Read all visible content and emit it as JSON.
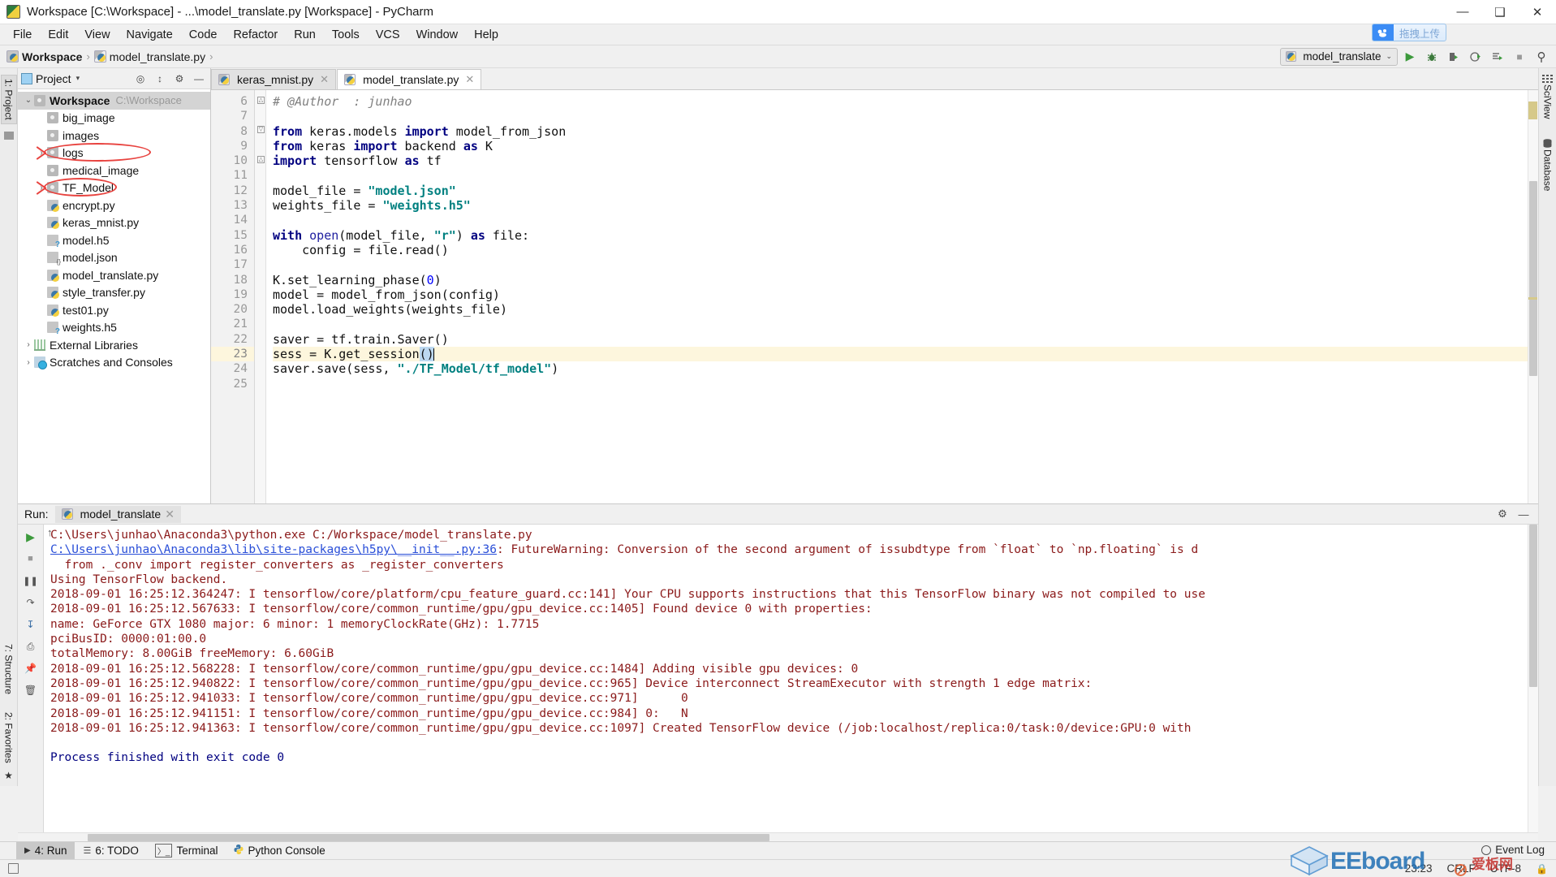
{
  "window": {
    "title": "Workspace [C:\\Workspace] - ...\\model_translate.py [Workspace] - PyCharm",
    "app_icon": "pycharm-icon",
    "minimize": "—",
    "maximize": "❑",
    "close": "✕"
  },
  "menu": {
    "items": [
      {
        "label": "File"
      },
      {
        "label": "Edit"
      },
      {
        "label": "View"
      },
      {
        "label": "Navigate"
      },
      {
        "label": "Code"
      },
      {
        "label": "Refactor"
      },
      {
        "label": "Run"
      },
      {
        "label": "Tools"
      },
      {
        "label": "VCS"
      },
      {
        "label": "Window"
      },
      {
        "label": "Help"
      }
    ]
  },
  "breadcrumb": {
    "project": "Workspace",
    "separator": "›",
    "file": "model_translate.py"
  },
  "toolbar": {
    "run_config": "model_translate",
    "run_config_caret": "⌄",
    "buttons": [
      {
        "name": "run-button",
        "glyph": "▶",
        "color": "#3c9a3c"
      },
      {
        "name": "debug-button",
        "glyph": "🐞",
        "color": "#3c7a3c"
      },
      {
        "name": "run-coverage-button",
        "glyph": "▶",
        "color": "#444"
      },
      {
        "name": "profile-button",
        "glyph": "◔",
        "color": "#444"
      },
      {
        "name": "run-with-button",
        "glyph": "≡",
        "color": "#444"
      },
      {
        "name": "stop-button",
        "glyph": "■",
        "color": "#9a9a9a"
      },
      {
        "name": "search-everywhere-button",
        "glyph": "⌕",
        "color": "#444"
      }
    ]
  },
  "baidu_upload": {
    "icon": "cloud-icon",
    "label": "拖拽上传"
  },
  "left_rail": {
    "tabs": [
      {
        "label": "1: Project"
      }
    ],
    "favorites": "2: Favorites",
    "structure": "7: Structure"
  },
  "project_panel": {
    "title": "Project",
    "caret": "▾",
    "icons": [
      "locate-icon",
      "collapse-all-icon",
      "settings-icon",
      "hide-icon"
    ],
    "tree": [
      {
        "indent": 0,
        "arrow": "⌄",
        "icon": "folder",
        "label": "Workspace",
        "bold": true,
        "path": "C:\\Workspace",
        "selected": true
      },
      {
        "indent": 1,
        "arrow": "",
        "icon": "folder",
        "label": "big_image",
        "bold": false,
        "path": "",
        "selected": false
      },
      {
        "indent": 1,
        "arrow": "",
        "icon": "folder",
        "label": "images",
        "bold": false,
        "path": "",
        "selected": false
      },
      {
        "indent": 1,
        "arrow": "›",
        "icon": "folder",
        "label": "logs",
        "bold": false,
        "path": "",
        "selected": false,
        "annotated": true
      },
      {
        "indent": 1,
        "arrow": "",
        "icon": "folder",
        "label": "medical_image",
        "bold": false,
        "path": "",
        "selected": false
      },
      {
        "indent": 1,
        "arrow": "›",
        "icon": "folder",
        "label": "TF_Model",
        "bold": false,
        "path": "",
        "selected": false,
        "annotated": true
      },
      {
        "indent": 1,
        "arrow": "",
        "icon": "py",
        "label": "encrypt.py",
        "bold": false,
        "path": "",
        "selected": false
      },
      {
        "indent": 1,
        "arrow": "",
        "icon": "py",
        "label": "keras_mnist.py",
        "bold": false,
        "path": "",
        "selected": false
      },
      {
        "indent": 1,
        "arrow": "",
        "icon": "h5",
        "label": "model.h5",
        "bold": false,
        "path": "",
        "selected": false
      },
      {
        "indent": 1,
        "arrow": "",
        "icon": "json",
        "label": "model.json",
        "bold": false,
        "path": "",
        "selected": false
      },
      {
        "indent": 1,
        "arrow": "",
        "icon": "py",
        "label": "model_translate.py",
        "bold": false,
        "path": "",
        "selected": false
      },
      {
        "indent": 1,
        "arrow": "",
        "icon": "py",
        "label": "style_transfer.py",
        "bold": false,
        "path": "",
        "selected": false
      },
      {
        "indent": 1,
        "arrow": "",
        "icon": "py",
        "label": "test01.py",
        "bold": false,
        "path": "",
        "selected": false
      },
      {
        "indent": 1,
        "arrow": "",
        "icon": "h5",
        "label": "weights.h5",
        "bold": false,
        "path": "",
        "selected": false
      },
      {
        "indent": 0,
        "arrow": "›",
        "icon": "lib",
        "label": "External Libraries",
        "bold": false,
        "path": "",
        "selected": false
      },
      {
        "indent": 0,
        "arrow": "›",
        "icon": "scratch",
        "label": "Scratches and Consoles",
        "bold": false,
        "path": "",
        "selected": false
      }
    ]
  },
  "editor": {
    "tabs": [
      {
        "label": "keras_mnist.py",
        "active": false,
        "close": "✕"
      },
      {
        "label": "model_translate.py",
        "active": true,
        "close": "✕"
      }
    ],
    "first_line_number": 6,
    "current_line": 23,
    "lines": [
      {
        "n": 6,
        "tokens": [
          {
            "t": "comment",
            "v": "# @Author  : junhao"
          }
        ]
      },
      {
        "n": 7,
        "tokens": []
      },
      {
        "n": 8,
        "tokens": [
          {
            "t": "kw",
            "v": "from"
          },
          {
            "t": "p",
            "v": " keras.models "
          },
          {
            "t": "kw",
            "v": "import"
          },
          {
            "t": "p",
            "v": " model_from_json"
          }
        ]
      },
      {
        "n": 9,
        "tokens": [
          {
            "t": "kw",
            "v": "from"
          },
          {
            "t": "p",
            "v": " keras "
          },
          {
            "t": "kw",
            "v": "import"
          },
          {
            "t": "p",
            "v": " backend "
          },
          {
            "t": "kw",
            "v": "as"
          },
          {
            "t": "p",
            "v": " K"
          }
        ]
      },
      {
        "n": 10,
        "tokens": [
          {
            "t": "kw",
            "v": "import"
          },
          {
            "t": "p",
            "v": " tensorflow "
          },
          {
            "t": "kw",
            "v": "as"
          },
          {
            "t": "p",
            "v": " tf"
          }
        ]
      },
      {
        "n": 11,
        "tokens": []
      },
      {
        "n": 12,
        "tokens": [
          {
            "t": "p",
            "v": "model_file = "
          },
          {
            "t": "str",
            "v": "\"model.json\""
          }
        ]
      },
      {
        "n": 13,
        "tokens": [
          {
            "t": "p",
            "v": "weights_file = "
          },
          {
            "t": "str",
            "v": "\"weights.h5\""
          }
        ]
      },
      {
        "n": 14,
        "tokens": []
      },
      {
        "n": 15,
        "tokens": [
          {
            "t": "kw",
            "v": "with"
          },
          {
            "t": "p",
            "v": " "
          },
          {
            "t": "fn",
            "v": "open"
          },
          {
            "t": "p",
            "v": "(model_file, "
          },
          {
            "t": "str",
            "v": "\"r\""
          },
          {
            "t": "p",
            "v": ") "
          },
          {
            "t": "kw",
            "v": "as"
          },
          {
            "t": "p",
            "v": " file:"
          }
        ]
      },
      {
        "n": 16,
        "tokens": [
          {
            "t": "p",
            "v": "    config = file.read()"
          }
        ]
      },
      {
        "n": 17,
        "tokens": []
      },
      {
        "n": 18,
        "tokens": [
          {
            "t": "p",
            "v": "K.set_learning_phase("
          },
          {
            "t": "num",
            "v": "0"
          },
          {
            "t": "p",
            "v": ")"
          }
        ]
      },
      {
        "n": 19,
        "tokens": [
          {
            "t": "p",
            "v": "model = model_from_json(config)"
          }
        ]
      },
      {
        "n": 20,
        "tokens": [
          {
            "t": "p",
            "v": "model.load_weights(weights_file)"
          }
        ]
      },
      {
        "n": 21,
        "tokens": []
      },
      {
        "n": 22,
        "tokens": [
          {
            "t": "p",
            "v": "saver = tf.train.Saver()"
          }
        ]
      },
      {
        "n": 23,
        "tokens": [
          {
            "t": "p",
            "v": "sess = K.get_session"
          },
          {
            "t": "brkt",
            "v": "()"
          },
          {
            "t": "caret",
            "v": ""
          }
        ]
      },
      {
        "n": 24,
        "tokens": [
          {
            "t": "p",
            "v": "saver.save(sess, "
          },
          {
            "t": "str",
            "v": "\"./TF_Model/tf_model\""
          },
          {
            "t": "p",
            "v": ")"
          }
        ]
      },
      {
        "n": 25,
        "tokens": []
      }
    ]
  },
  "right_rail": {
    "tabs": [
      {
        "label": "SciView",
        "icon": "grid-icon"
      },
      {
        "label": "Database",
        "icon": "database-icon"
      }
    ]
  },
  "run_panel": {
    "label": "Run:",
    "tab": "model_translate",
    "tab_close": "✕",
    "side_buttons": [
      {
        "name": "rerun-button",
        "glyph": "▶"
      },
      {
        "name": "stop-button",
        "glyph": "■"
      },
      {
        "name": "pause-button",
        "glyph": "‖"
      },
      {
        "name": "print-button",
        "glyph": "⎙"
      },
      {
        "name": "soft-wrap-button",
        "glyph": "↵"
      },
      {
        "name": "scroll-to-end-button",
        "glyph": "↓"
      },
      {
        "name": "up-button",
        "glyph": "↑"
      },
      {
        "name": "pin-button",
        "glyph": "📌"
      },
      {
        "name": "clear-all-button",
        "glyph": "🗑"
      }
    ],
    "head_buttons": [
      {
        "name": "settings-icon",
        "glyph": "⚙"
      },
      {
        "name": "hide-icon",
        "glyph": "—"
      }
    ],
    "output": [
      {
        "style": "err",
        "text": "C:\\Users\\junhao\\Anaconda3\\python.exe C:/Workspace/model_translate.py"
      },
      {
        "style": "link-warn",
        "link": "C:\\Users\\junhao\\Anaconda3\\lib\\site-packages\\h5py\\__init__.py:36",
        "text": ": FutureWarning: Conversion of the second argument of issubdtype from `float` to `np.floating` is d"
      },
      {
        "style": "err",
        "text": "  from ._conv import register_converters as _register_converters"
      },
      {
        "style": "err",
        "text": "Using TensorFlow backend."
      },
      {
        "style": "err",
        "text": "2018-09-01 16:25:12.364247: I tensorflow/core/platform/cpu_feature_guard.cc:141] Your CPU supports instructions that this TensorFlow binary was not compiled to use"
      },
      {
        "style": "err",
        "text": "2018-09-01 16:25:12.567633: I tensorflow/core/common_runtime/gpu/gpu_device.cc:1405] Found device 0 with properties:"
      },
      {
        "style": "err",
        "text": "name: GeForce GTX 1080 major: 6 minor: 1 memoryClockRate(GHz): 1.7715"
      },
      {
        "style": "err",
        "text": "pciBusID: 0000:01:00.0"
      },
      {
        "style": "err",
        "text": "totalMemory: 8.00GiB freeMemory: 6.60GiB"
      },
      {
        "style": "err",
        "text": "2018-09-01 16:25:12.568228: I tensorflow/core/common_runtime/gpu/gpu_device.cc:1484] Adding visible gpu devices: 0"
      },
      {
        "style": "err",
        "text": "2018-09-01 16:25:12.940822: I tensorflow/core/common_runtime/gpu/gpu_device.cc:965] Device interconnect StreamExecutor with strength 1 edge matrix:"
      },
      {
        "style": "err",
        "text": "2018-09-01 16:25:12.941033: I tensorflow/core/common_runtime/gpu/gpu_device.cc:971]      0"
      },
      {
        "style": "err",
        "text": "2018-09-01 16:25:12.941151: I tensorflow/core/common_runtime/gpu/gpu_device.cc:984] 0:   N"
      },
      {
        "style": "err",
        "text": "2018-09-01 16:25:12.941363: I tensorflow/core/common_runtime/gpu/gpu_device.cc:1097] Created TensorFlow device (/job:localhost/replica:0/task:0/device:GPU:0 with"
      },
      {
        "style": "blank",
        "text": ""
      },
      {
        "style": "ok",
        "text": "Process finished with exit code 0"
      }
    ]
  },
  "tool_window_bar": {
    "items": [
      {
        "label": "4: Run",
        "glyph": "▶",
        "active": true
      },
      {
        "label": "6: TODO",
        "glyph": "≡",
        "active": false
      },
      {
        "label": "Terminal",
        "glyph": "▷_",
        "active": false
      },
      {
        "label": "Python Console",
        "glyph": "py",
        "active": false
      }
    ]
  },
  "status_bar": {
    "left_icon": "stack-icon",
    "event_log": "Event Log",
    "time": "23:23",
    "line_sep": "CRLF",
    "encoding": "UTF-8",
    "caret_glyph": "↕"
  },
  "watermark": {
    "text": "EEboard",
    "cn": "爱板网"
  },
  "colors": {
    "keyword": "#000080",
    "string": "#008080",
    "number": "#0000ff",
    "comment": "#808080",
    "console_error": "#8b1a1a",
    "console_link": "#2a4fd8",
    "console_ok": "#000080",
    "annotation_red": "#e8433f",
    "current_line_bg": "#fdf6dd",
    "selection_blue": "#bcd8f0"
  }
}
